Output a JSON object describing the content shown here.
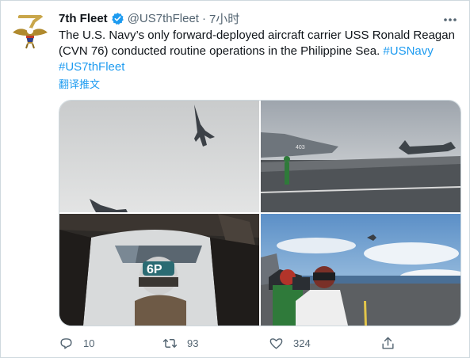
{
  "tweet": {
    "display_name": "7th Fleet",
    "handle": "@US7thFleet",
    "separator": "·",
    "time": "7小时",
    "text_main": "The U.S. Navy’s only forward-deployed aircraft carrier USS Ronald Reagan (CVN 76) conducted routine operations in the Philippine Sea.",
    "hashtag1": "#USNavy",
    "hashtag2": "#US7thFleet",
    "translate": "翻译推文"
  },
  "photo_markings": {
    "jet_number": "403",
    "helmet_number": "6P"
  },
  "actions": {
    "replies": "10",
    "retweets": "93",
    "likes": "324"
  },
  "colors": {
    "accent": "#1d9bf0",
    "text": "#0f1419",
    "secondary": "#536471",
    "border": "#cfd9de"
  }
}
